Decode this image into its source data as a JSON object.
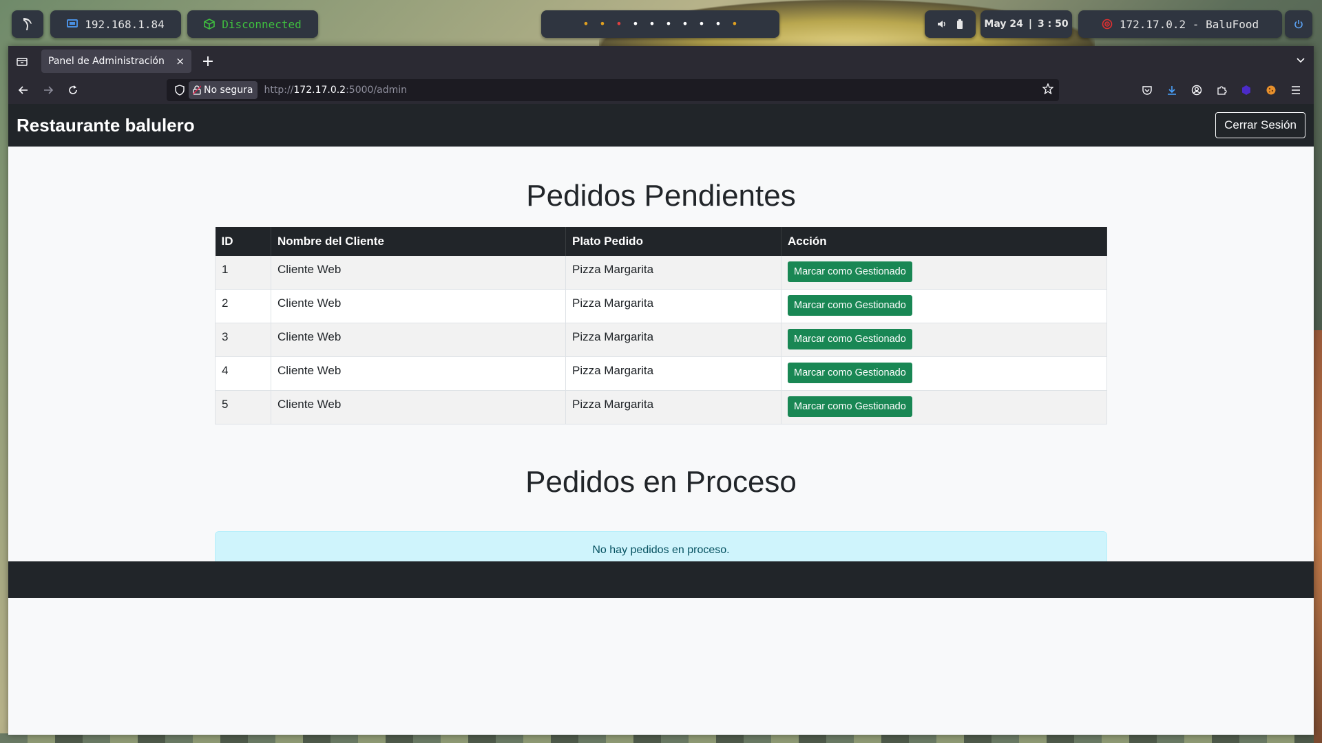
{
  "panel": {
    "local_ip": "192.168.1.84",
    "vpn_status": "Disconnected",
    "workspaces": [
      "•",
      "•",
      "•",
      "•",
      "•",
      "•",
      "•",
      "•",
      "•",
      "•"
    ],
    "workspace_colors": [
      "#e0a020",
      "#e0a020",
      "#e04040",
      "#ffffff",
      "#ffffff",
      "#ffffff",
      "#ffffff",
      "#ffffff",
      "#ffffff",
      "#e0a020"
    ],
    "date": "May 24",
    "separator": "|",
    "time": "3 : 50",
    "target": "172.17.0.2 - BaluFood"
  },
  "browser": {
    "tab_title": "Panel de Administración",
    "tab_close": "×",
    "new_tab": "+",
    "insecure_label": "No segura",
    "url_scheme": "http://",
    "url_host": "172.17.0.2",
    "url_path": ":5000/admin"
  },
  "site": {
    "brand": "Restaurante balulero",
    "logout_label": "Cerrar Sesión",
    "pending_title": "Pedidos Pendientes",
    "table_headers": {
      "id": "ID",
      "name": "Nombre del Cliente",
      "plate": "Plato Pedido",
      "action": "Acción"
    },
    "orders": [
      {
        "id": "1",
        "name": "Cliente Web",
        "plate": "Pizza Margarita",
        "action": "Marcar como Gestionado"
      },
      {
        "id": "2",
        "name": "Cliente Web",
        "plate": "Pizza Margarita",
        "action": "Marcar como Gestionado"
      },
      {
        "id": "3",
        "name": "Cliente Web",
        "plate": "Pizza Margarita",
        "action": "Marcar como Gestionado"
      },
      {
        "id": "4",
        "name": "Cliente Web",
        "plate": "Pizza Margarita",
        "action": "Marcar como Gestionado"
      },
      {
        "id": "5",
        "name": "Cliente Web",
        "plate": "Pizza Margarita",
        "action": "Marcar como Gestionado"
      }
    ],
    "in_process_title": "Pedidos en Proceso",
    "in_process_empty": "No hay pedidos en proceso."
  },
  "colors": {
    "header_bg": "#212529",
    "success": "#198754",
    "alert_bg": "#cff4fc"
  }
}
